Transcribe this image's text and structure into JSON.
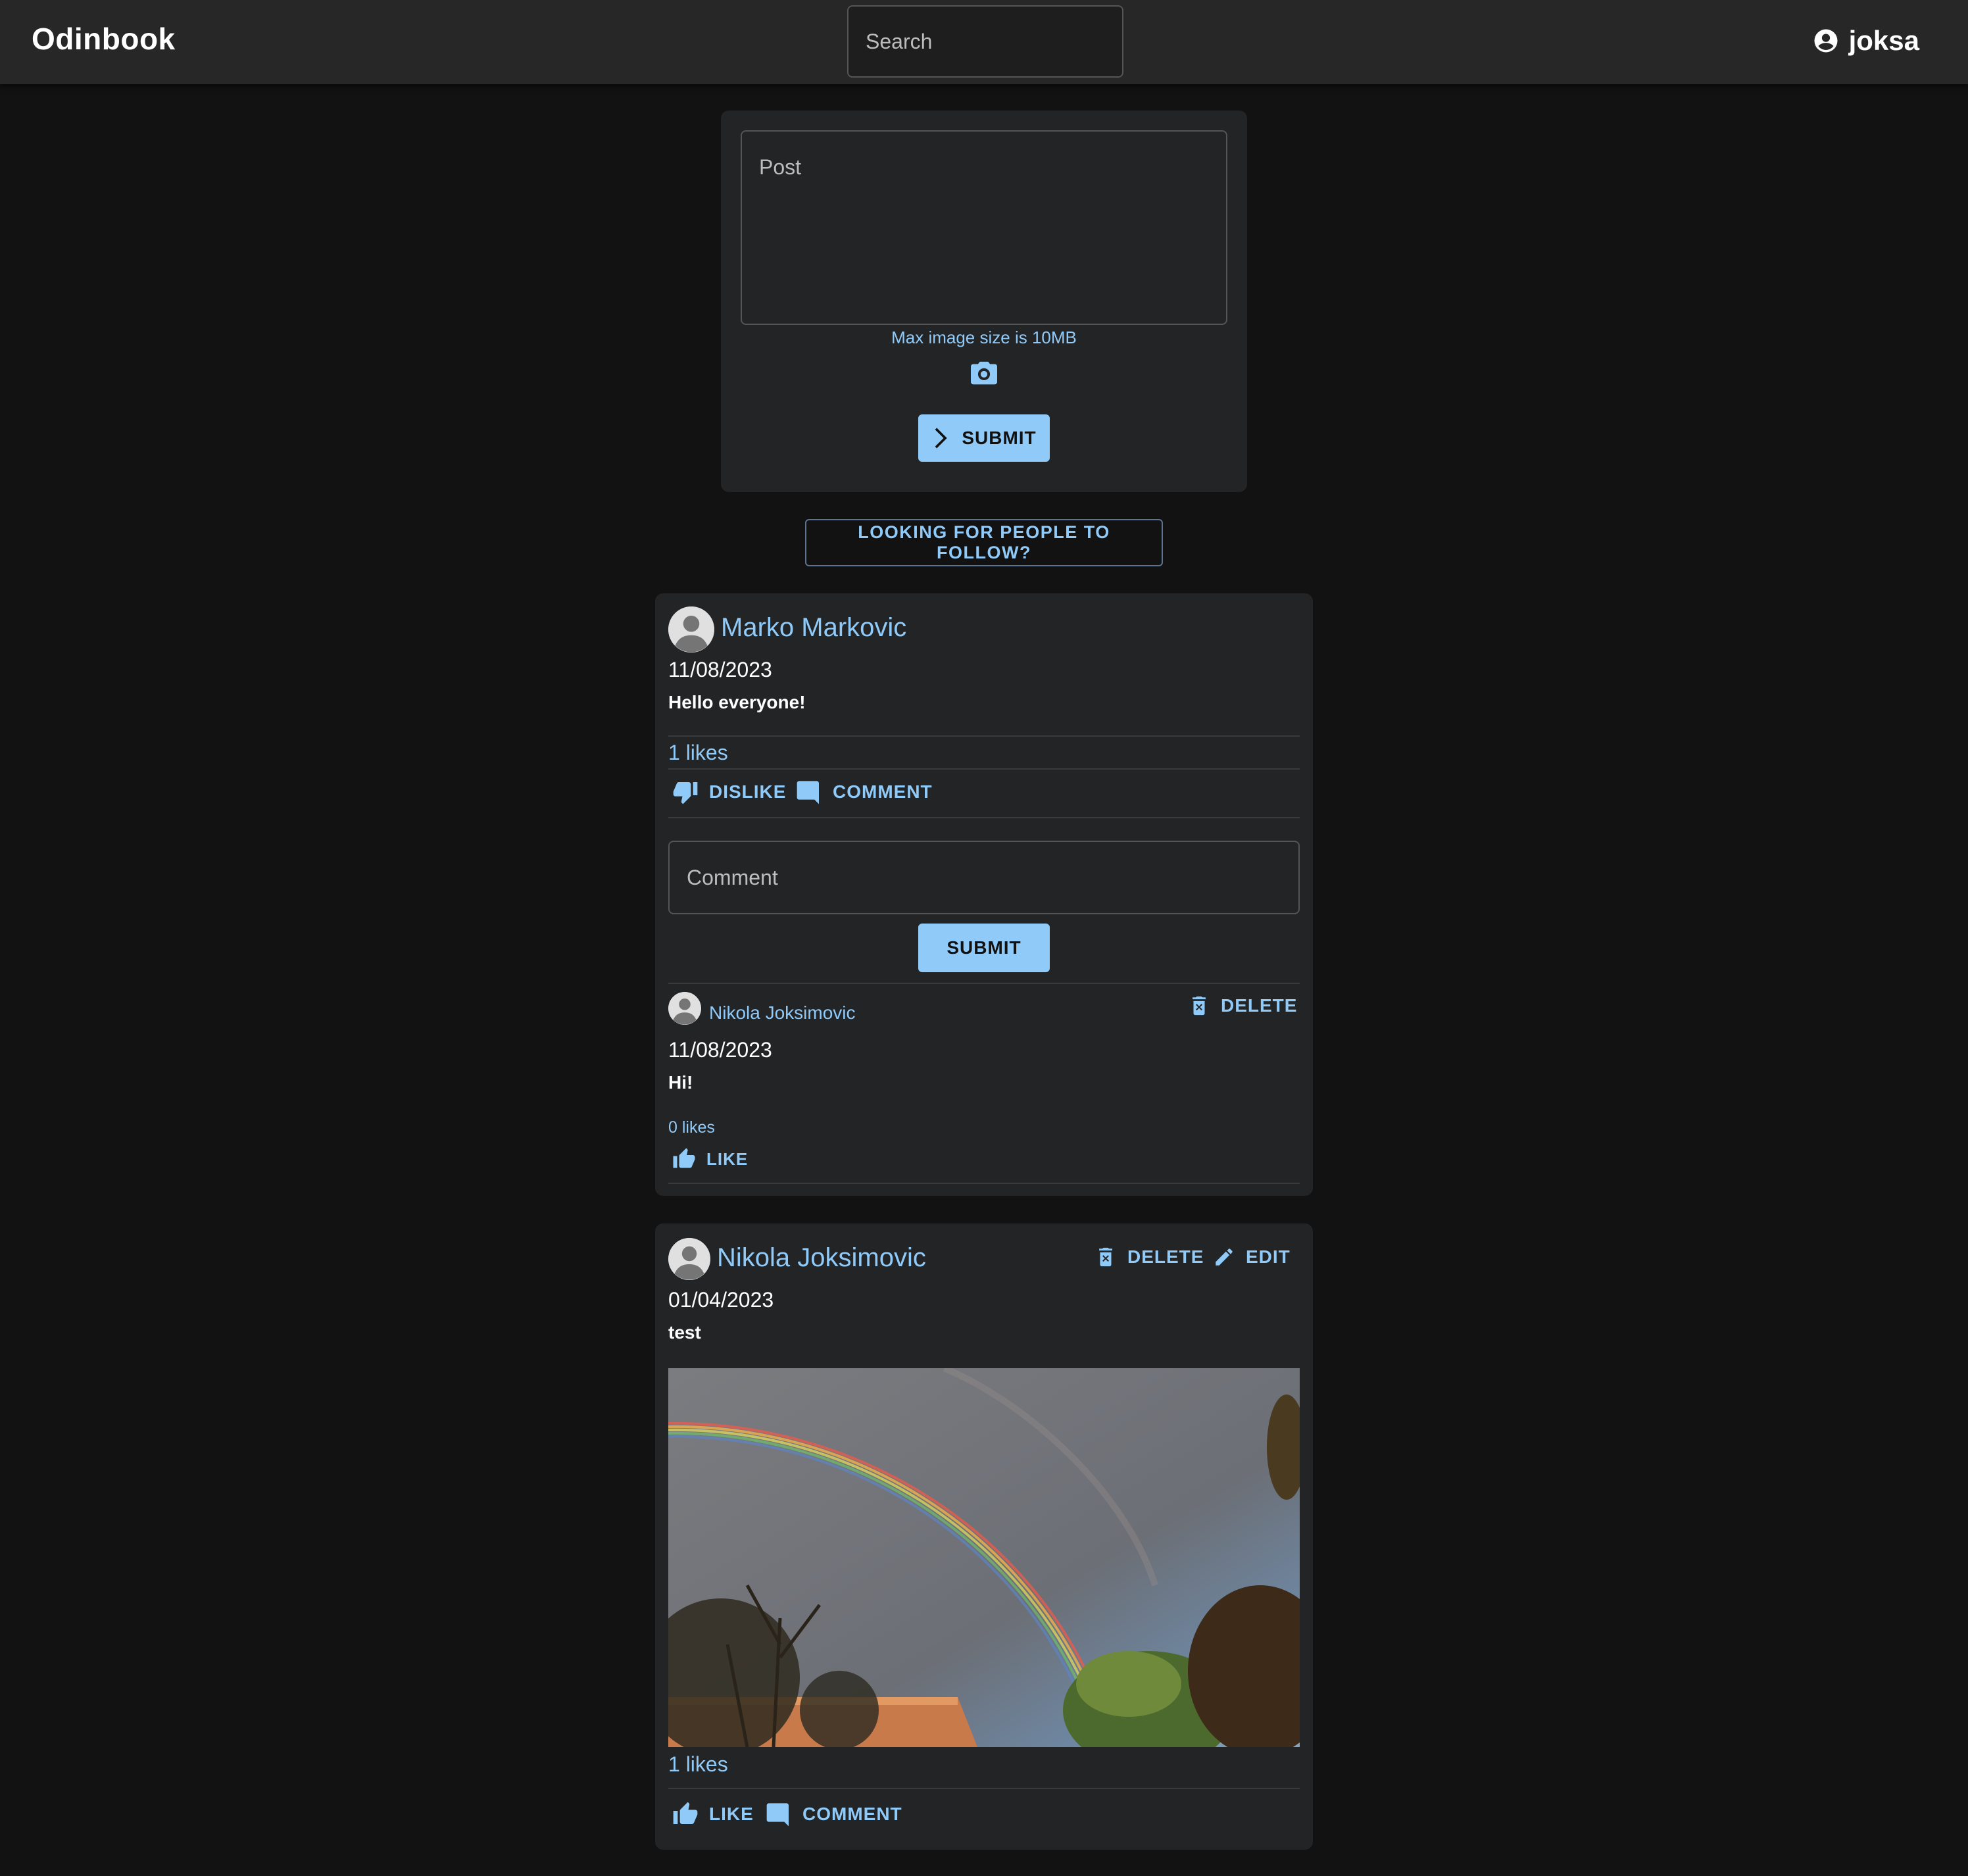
{
  "appbar": {
    "brand": "Odinbook",
    "search_placeholder": "Search",
    "username": "joksa"
  },
  "composer": {
    "placeholder": "Post",
    "max_image_note": "Max image size is 10MB",
    "submit_label": "SUBMIT"
  },
  "follow_button": "LOOKING FOR PEOPLE TO FOLLOW?",
  "posts": [
    {
      "author": "Marko Markovic",
      "date": "11/08/2023",
      "text": "Hello everyone!",
      "likes": "1 likes",
      "like_action": "DISLIKE",
      "comment_action": "COMMENT",
      "comment_placeholder": "Comment",
      "comment_submit": "SUBMIT",
      "comments": [
        {
          "author": "Nikola Joksimovic",
          "date": "11/08/2023",
          "text": "Hi!",
          "likes": "0 likes",
          "like_action": "LIKE",
          "delete_action": "DELETE"
        }
      ]
    },
    {
      "author": "Nikola Joksimovic",
      "date": "01/04/2023",
      "text": "test",
      "likes": "1 likes",
      "like_action": "LIKE",
      "comment_action": "COMMENT",
      "delete_action": "DELETE",
      "edit_action": "EDIT",
      "has_image": true
    }
  ],
  "colors": {
    "background": "#121212",
    "card": "#232426",
    "appbar": "#272727",
    "accent": "#90caf9"
  }
}
